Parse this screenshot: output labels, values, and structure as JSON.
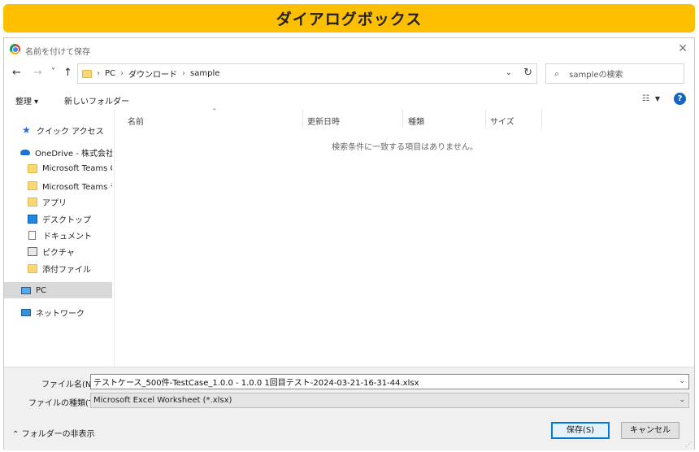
{
  "banner": {
    "title": "ダイアログボックス"
  },
  "dialog": {
    "title": "名前を付けて保存",
    "close_glyph": "✕"
  },
  "nav": {
    "back_glyph": "←",
    "forward_glyph": "→",
    "recent_glyph": "˅",
    "up_glyph": "↑",
    "breadcrumb": [
      "PC",
      "ダウンロード",
      "sample"
    ],
    "separator": "›",
    "refresh_glyph": "↻",
    "dropdown_glyph": "⌄",
    "search_placeholder": "sampleの検索"
  },
  "toolbar": {
    "organize": "整理 ▾",
    "new_folder": "新しいフォルダー",
    "help": "?"
  },
  "sidebar": {
    "items": [
      {
        "label": "クイック アクセス",
        "icon": "pin-star-icon",
        "kind": "star"
      },
      {
        "label": "OneDrive - 株式会社パ",
        "icon": "onedrive-cloud-icon",
        "kind": "cloud"
      },
      {
        "label": "Microsoft Teams Ch",
        "icon": "folder-icon",
        "kind": "fold"
      },
      {
        "label": "Microsoft Teams チャ",
        "icon": "folder-icon",
        "kind": "fold"
      },
      {
        "label": "アプリ",
        "icon": "folder-icon",
        "kind": "fold"
      },
      {
        "label": "デスクトップ",
        "icon": "desktop-icon",
        "kind": "desk"
      },
      {
        "label": "ドキュメント",
        "icon": "document-icon",
        "kind": "doc"
      },
      {
        "label": "ピクチャ",
        "icon": "pictures-icon",
        "kind": "pic"
      },
      {
        "label": "添付ファイル",
        "icon": "folder-icon",
        "kind": "fold"
      },
      {
        "label": "PC",
        "icon": "pc-icon",
        "kind": "pc",
        "selected": true
      },
      {
        "label": "ネットワーク",
        "icon": "network-icon",
        "kind": "net"
      }
    ]
  },
  "columns": [
    "名前",
    "更新日時",
    "種類",
    "サイズ"
  ],
  "empty_message": "検索条件に一致する項目はありません。",
  "bottom": {
    "filename_label": "ファイル名(N):",
    "filename_value": "テストケース_500件-TestCase_1.0.0 - 1.0.0 1回目テスト-2024-03-21-16-31-44.xlsx",
    "filetype_label": "ファイルの種類(T):",
    "filetype_value": "Microsoft Excel Worksheet (*.xlsx)",
    "hide_folders": "フォルダーの非表示",
    "save_button": "保存(S)",
    "cancel_button": "キャンセル"
  }
}
